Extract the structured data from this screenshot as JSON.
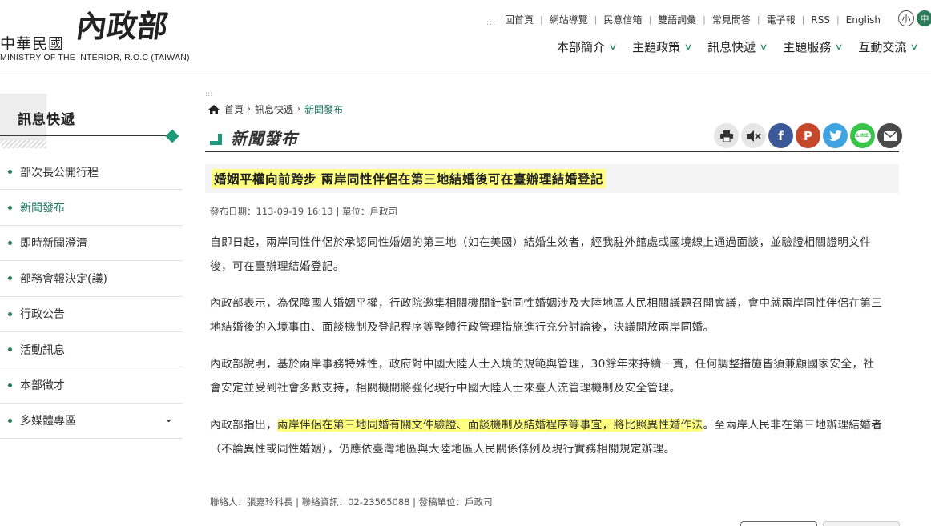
{
  "header": {
    "logo_roc": "中華民國",
    "logo_moi": "內政部",
    "logo_en": "MINISTRY OF THE INTERIOR, R.O.C (TAIWAN)",
    "top_links": [
      "回首頁",
      "網站導覽",
      "民意信箱",
      "雙語詞彙",
      "常見問答",
      "電子報",
      "RSS",
      "English"
    ],
    "font_small": "小",
    "font_medium": "中",
    "main_nav": [
      "本部簡介",
      "主題政策",
      "訊息快遞",
      "主題服務",
      "互動交流"
    ]
  },
  "sidebar": {
    "title": "訊息快遞",
    "items": [
      {
        "label": "部次長公開行程"
      },
      {
        "label": "新聞發布"
      },
      {
        "label": "即時新聞澄清"
      },
      {
        "label": "部務會報決定(議)"
      },
      {
        "label": "行政公告"
      },
      {
        "label": "活動訊息"
      },
      {
        "label": "本部徵才"
      },
      {
        "label": "多媒體專區"
      }
    ]
  },
  "breadcrumb": {
    "home": "首頁",
    "level1": "訊息快遞",
    "current": "新聞發布"
  },
  "page": {
    "title": "新聞發布",
    "share_icons": [
      "print-icon",
      "sound-icon",
      "facebook-icon",
      "plurk-icon",
      "twitter-icon",
      "line-icon",
      "email-icon"
    ],
    "share_line_label": "LINE"
  },
  "article": {
    "title": "婚姻平權向前跨步 兩岸同性伴侶在第三地結婚後可在臺辦理結婚登記",
    "meta": "發布日期：113-09-19 16:13 | 單位：戶政司",
    "p1": "自即日起，兩岸同性伴侶於承認同性婚姻的第三地（如在美國）結婚生效者，經我駐外館處或國境線上通過面談，並驗證相關證明文件後，可在臺辦理結婚登記。",
    "p2": "內政部表示，為保障國人婚姻平權，行政院邀集相關機關針對同性婚姻涉及大陸地區人民相關議題召開會議，會中就兩岸同性伴侶在第三地結婚後的入境事由、面談機制及登記程序等整體行政管理措施進行充分討論後，決議開放兩岸同婚。",
    "p3": "內政部說明，基於兩岸事務特殊性，政府對中國大陸人士入境的規範與管理，30餘年來持續一貫，任何調整措施皆須兼顧國家安全，社會安定並受到社會多數支持，相關機關將強化現行中國大陸人士來臺人流管理機制及安全管理。",
    "p4_pre": "內政部指出，",
    "p4_hl": "兩岸伴侶在第三地同婚有關文件驗證、面談機制及結婚程序等事宜，將比照異性婚作法",
    "p4_post": "。至兩岸人民非在第三地辦理結婚者（不論異性或同性婚姻），仍應依臺灣地區與大陸地區人民關係條例及現行實務相關規定辦理。",
    "contact": "聯絡人：張嘉玲科長 | 聯絡資訊：02-23565088 | 發稿單位：戶政司"
  },
  "colors": {
    "accent": "#1e9a7a",
    "highlight": "#ffff80",
    "active_link": "#1e7a60"
  }
}
